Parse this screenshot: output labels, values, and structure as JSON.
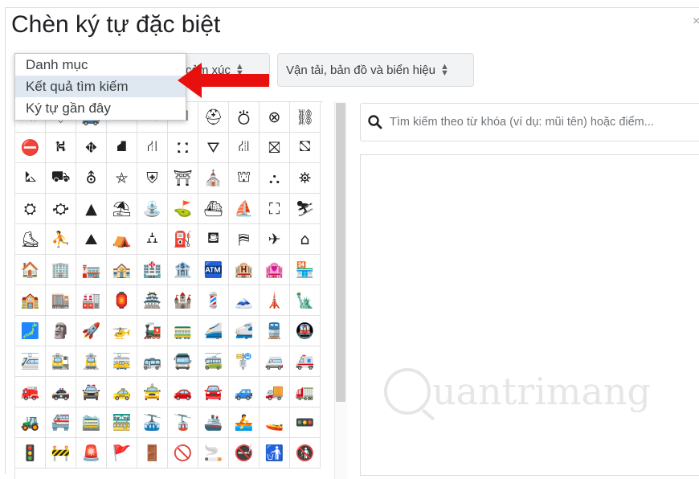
{
  "dialog": {
    "title": "Chèn ký tự đặc biệt",
    "close_label": "×"
  },
  "category_select": {
    "value": "cảm xúc"
  },
  "subcategory_select": {
    "value": "Vận tải, bản đồ và biển hiệu"
  },
  "dropdown": {
    "items": [
      "Danh mục",
      "Kết quả tìm kiếm",
      "Ký tự gần đây"
    ],
    "selected_index": 1
  },
  "search": {
    "placeholder": "Tìm kiếm theo từ khóa (ví dụ: mũi tên) hoặc điểm..."
  },
  "watermark": {
    "text": "uantrimang"
  },
  "symbols": [
    "⛐",
    "⛗",
    "🚙",
    "⛟",
    "✎",
    "⛠",
    "⛑",
    "⛣",
    "⊗",
    "⛓",
    "⛔",
    "⛕",
    "⛖",
    "⛘",
    "⛙",
    "⛚",
    "⛛",
    "⛜",
    "⛝",
    "⛞",
    "⛡",
    "⛟",
    "⛢",
    "⛤",
    "⛨",
    "⛩",
    "⛪",
    "⛫",
    "⛬",
    "⛯",
    "⛭",
    "⛮",
    "▲",
    "⛱",
    "⛲",
    "⛳",
    "⛴",
    "⛵",
    "⛶",
    "⛷",
    "⛸",
    "⛹",
    "⛰",
    "⛺",
    "⛼",
    "⛽",
    "⛾",
    "⛿",
    "✈",
    "⌂",
    "🏠",
    "🏢",
    "🏣",
    "🏤",
    "🏥",
    "🏦",
    "🏧",
    "🏨",
    "🏩",
    "🏪",
    "🏫",
    "🏬",
    "🏭",
    "🏮",
    "🏯",
    "🏰",
    "💈",
    "🗻",
    "🗼",
    "🗽",
    "🗾",
    "🗿",
    "🚀",
    "🚁",
    "🚂",
    "🚃",
    "🚄",
    "🚅",
    "🚆",
    "🚇",
    "🚈",
    "🚉",
    "🚊",
    "🚋",
    "🚌",
    "🚍",
    "🚎",
    "🚏",
    "🚐",
    "🚑",
    "🚒",
    "🚓",
    "🚔",
    "🚕",
    "🚖",
    "🚗",
    "🚘",
    "🚙",
    "🚚",
    "🚛",
    "🚜",
    "🚝",
    "🚞",
    "🚟",
    "🚠",
    "🚡",
    "🚢",
    "🚣",
    "🚤",
    "🚥",
    "🚦",
    "🚧",
    "🚨",
    "🚩",
    "🚪",
    "🚫",
    "🚬",
    "🚭",
    "🚮",
    "🚯"
  ],
  "colors": {
    "dropdown_selected": "#dfe7f1",
    "arrow": "#e8100f"
  }
}
